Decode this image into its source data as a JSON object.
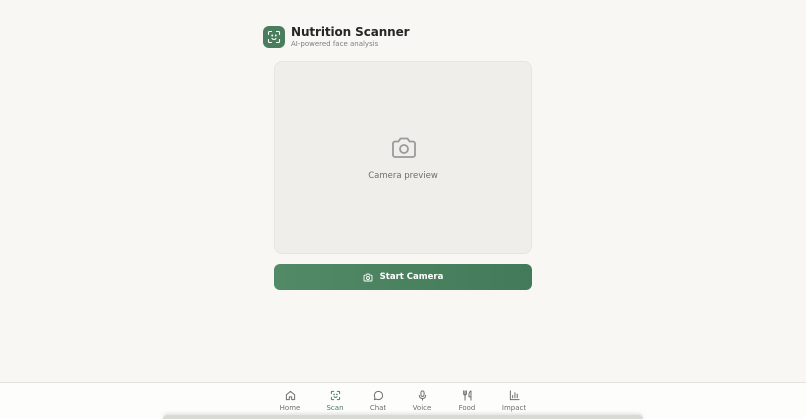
{
  "header": {
    "title": "Nutrition Scanner",
    "subtitle": "AI-powered face analysis",
    "logo_icon": "scan-face-icon"
  },
  "preview": {
    "label": "Camera preview",
    "icon": "camera-icon"
  },
  "start_button": {
    "label": "Start Camera",
    "icon": "camera-icon"
  },
  "nav": {
    "items": [
      {
        "label": "Home",
        "icon": "home-icon",
        "active": false
      },
      {
        "label": "Scan",
        "icon": "scan-icon",
        "active": true
      },
      {
        "label": "Chat",
        "icon": "chat-icon",
        "active": false
      },
      {
        "label": "Voice",
        "icon": "microphone-icon",
        "active": false
      },
      {
        "label": "Food",
        "icon": "utensils-icon",
        "active": false
      },
      {
        "label": "Impact",
        "icon": "bar-chart-icon",
        "active": false
      }
    ]
  },
  "colors": {
    "accent": "#4a7d5e",
    "background": "#f8f7f4",
    "muted_text": "#6f6f6f"
  }
}
